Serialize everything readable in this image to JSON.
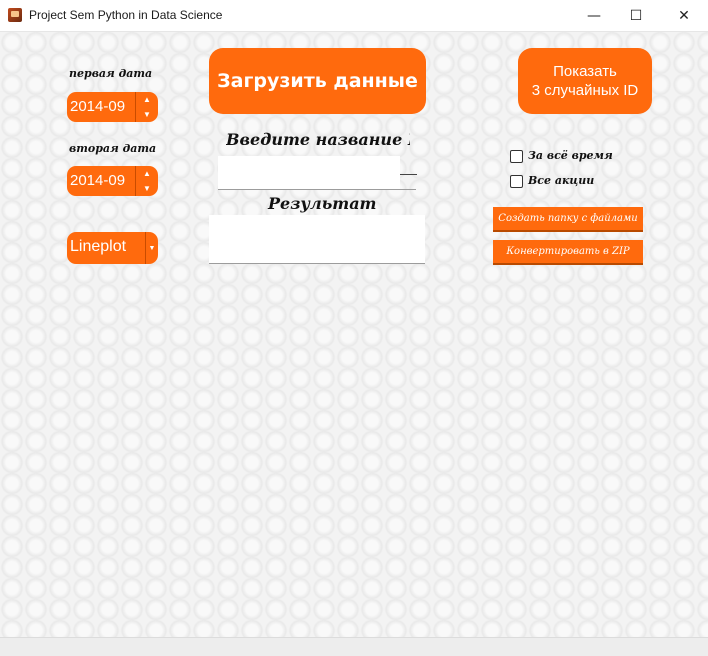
{
  "window": {
    "title": "Project Sem Python in Data Science",
    "minimize_glyph": "—",
    "maximize_glyph": "☐",
    "close_glyph": "✕"
  },
  "left": {
    "first_date_label": "первая дата",
    "first_date_value": "2014-09",
    "second_date_label": "вторая дата",
    "second_date_value": "2014-09",
    "plot_type_value": "Lineplot"
  },
  "center": {
    "load_button": "Загрузить данные",
    "id_label": "Введите название ID :",
    "id_input_value": "",
    "result_label": "Результат",
    "result_value": ""
  },
  "right": {
    "show_random_button_line1": "Показать",
    "show_random_button_line2": "3 случайных ID",
    "all_time_checkbox": "За всё время",
    "all_shares_checkbox": "Все акции",
    "create_folder_button": "Создать папку с файлами",
    "convert_zip_button": "Конвертировать в ZIP"
  },
  "colors": {
    "accent": "#ff6a0d"
  }
}
